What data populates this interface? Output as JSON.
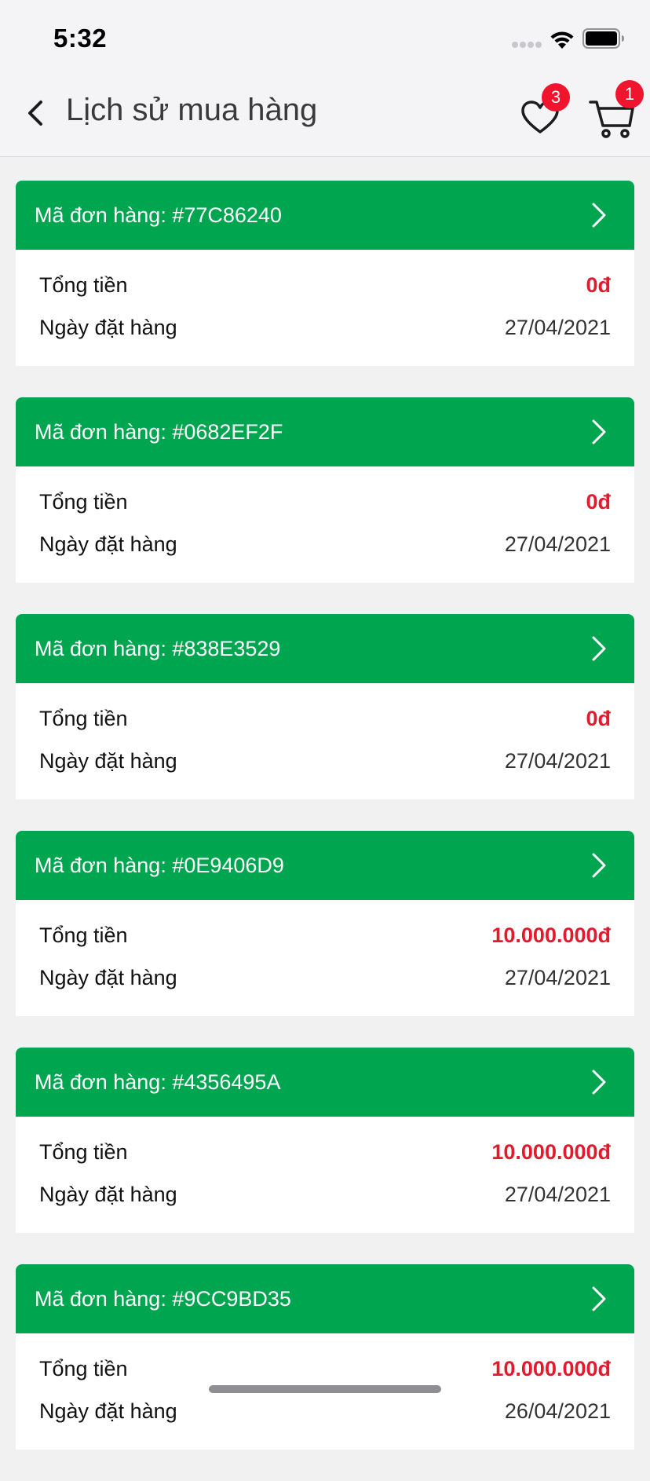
{
  "status_bar": {
    "time": "5:32"
  },
  "header": {
    "title": "Lịch sử mua hàng",
    "wishlist_badge": "3",
    "cart_badge": "1"
  },
  "labels": {
    "total": "Tổng tiền",
    "order_date": "Ngày đặt hàng"
  },
  "orders": [
    {
      "code": "Mã đơn hàng: #77C86240",
      "total": "0đ",
      "date": "27/04/2021"
    },
    {
      "code": "Mã đơn hàng: #0682EF2F",
      "total": "0đ",
      "date": "27/04/2021"
    },
    {
      "code": "Mã đơn hàng: #838E3529",
      "total": "0đ",
      "date": "27/04/2021"
    },
    {
      "code": "Mã đơn hàng: #0E9406D9",
      "total": "10.000.000đ",
      "date": "27/04/2021"
    },
    {
      "code": "Mã đơn hàng: #4356495A",
      "total": "10.000.000đ",
      "date": "27/04/2021"
    },
    {
      "code": "Mã đơn hàng: #9CC9BD35",
      "total": "10.000.000đ",
      "date": "26/04/2021"
    }
  ],
  "colors": {
    "accent": "#00a550",
    "price": "#e3192c",
    "badge": "#f0142f"
  },
  "icons": [
    "back-chevron-icon",
    "heart-icon",
    "cart-icon",
    "chevron-right-icon",
    "wifi-icon",
    "battery-icon"
  ]
}
